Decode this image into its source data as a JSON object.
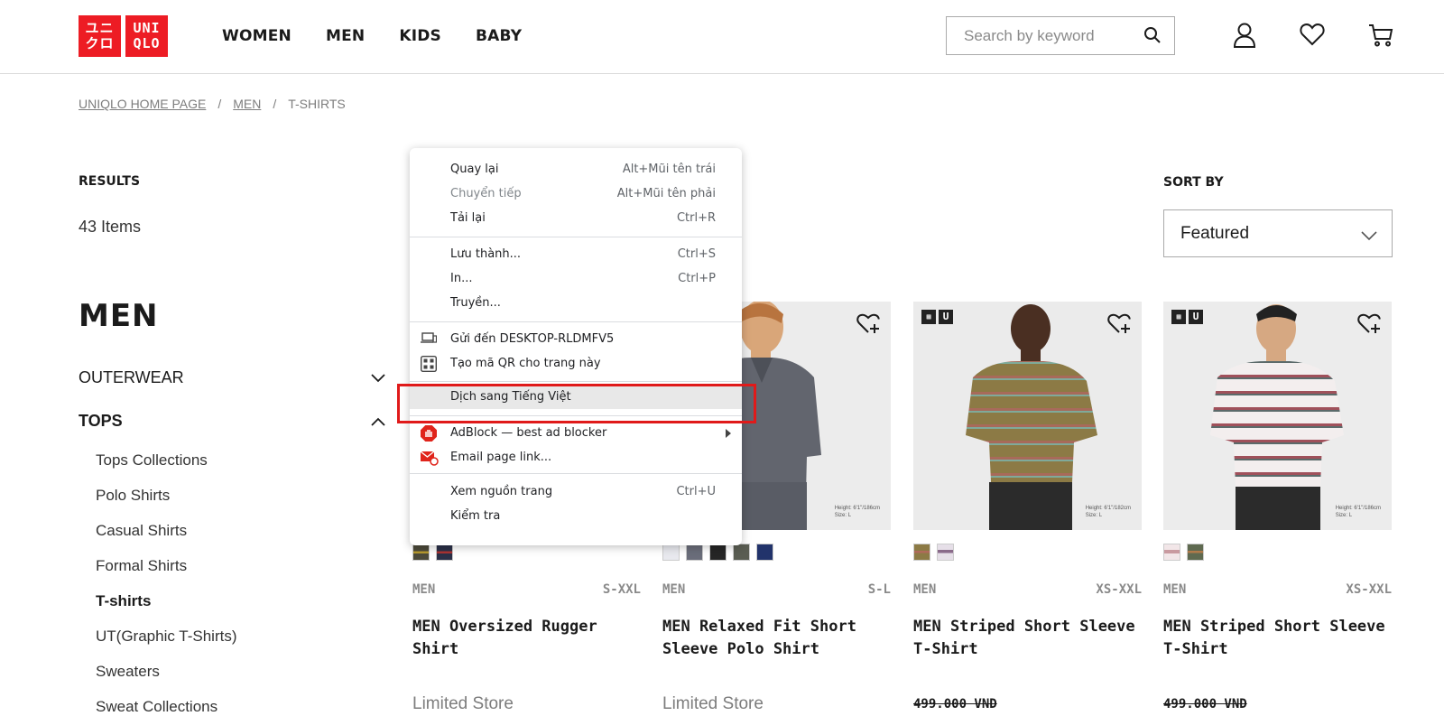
{
  "header": {
    "logo_top": [
      "ユニ",
      "クロ"
    ],
    "logo_right": [
      "UNI",
      "QLO"
    ],
    "nav": [
      "WOMEN",
      "MEN",
      "KIDS",
      "BABY"
    ],
    "search_placeholder": "Search by keyword"
  },
  "breadcrumb": {
    "home": "UNIQLO HOME PAGE",
    "men": "MEN",
    "current": "T-SHIRTS",
    "sep": "/"
  },
  "results": {
    "label": "RESULTS",
    "count": "43 Items"
  },
  "sidebar": {
    "title": "MEN",
    "categories": [
      {
        "label": "OUTERWEAR",
        "expanded": false
      },
      {
        "label": "TOPS",
        "expanded": true
      }
    ],
    "subcategories": [
      "Tops Collections",
      "Polo Shirts",
      "Casual Shirts",
      "Formal Shirts",
      "T-shirts",
      "UT(Graphic T-Shirts)",
      "Sweaters",
      "Sweat Collections"
    ],
    "active_subcategory": "T-shirts"
  },
  "sort": {
    "label": "SORT BY",
    "value": "Featured"
  },
  "products": [
    {
      "gender": "MEN",
      "sizes": "S-XXL",
      "title": "MEN Oversized Rugger Shirt",
      "store": "Limited Store",
      "price": "",
      "swatches": [
        "#4c4a3a",
        "#2b3048"
      ],
      "height_note": ""
    },
    {
      "gender": "MEN",
      "sizes": "S-L",
      "title": "MEN Relaxed Fit Short Sleeve Polo Shirt",
      "store": "Limited Store",
      "price": "",
      "swatches": [
        "#e8e9ee",
        "#6a6d7a",
        "#262626",
        "#5a5d52",
        "#22336b"
      ],
      "height_note": "Height: 6'1\"/186cm\nSize: L"
    },
    {
      "gender": "MEN",
      "sizes": "XS-XXL",
      "title": "MEN Striped Short Sleeve T-Shirt",
      "store": "",
      "price": "499.000 VND",
      "swatches": [
        "#8c7a45",
        "#b8a8b8"
      ],
      "height_note": "Height: 6'1\"/182cm\nSize: L"
    },
    {
      "gender": "MEN",
      "sizes": "XS-XXL",
      "title": "MEN Striped Short Sleeve T-Shirt",
      "store": "",
      "price": "499.000 VND",
      "swatches": [
        "#e8c8cc",
        "#5f6a50"
      ],
      "height_note": "Height: 6'1\"/186cm\nSize: L"
    }
  ],
  "context_menu": {
    "items": [
      {
        "label": "Quay lại",
        "shortcut": "Alt+Mũi tên trái",
        "disabled": false
      },
      {
        "label": "Chuyển tiếp",
        "shortcut": "Alt+Mũi tên phải",
        "disabled": true
      },
      {
        "label": "Tải lại",
        "shortcut": "Ctrl+R",
        "disabled": false
      },
      {
        "label": "Lưu thành...",
        "shortcut": "Ctrl+S",
        "disabled": false
      },
      {
        "label": "In...",
        "shortcut": "Ctrl+P",
        "disabled": false
      },
      {
        "label": "Truyền...",
        "shortcut": "",
        "disabled": false
      },
      {
        "label": "Gửi đến DESKTOP-RLDMFV5",
        "shortcut": "",
        "disabled": false
      },
      {
        "label": "Tạo mã QR cho trang này",
        "shortcut": "",
        "disabled": false
      },
      {
        "label": "Dịch sang Tiếng Việt",
        "shortcut": "",
        "disabled": false
      },
      {
        "label": "AdBlock — best ad blocker",
        "shortcut": "",
        "disabled": false
      },
      {
        "label": "Email page link...",
        "shortcut": "",
        "disabled": false
      },
      {
        "label": "Xem nguồn trang",
        "shortcut": "Ctrl+U",
        "disabled": false
      },
      {
        "label": "Kiểm tra",
        "shortcut": "",
        "disabled": false
      }
    ]
  },
  "colors": {
    "brand_red": "#ed1c24",
    "highlight_box": "#e01a1a"
  }
}
